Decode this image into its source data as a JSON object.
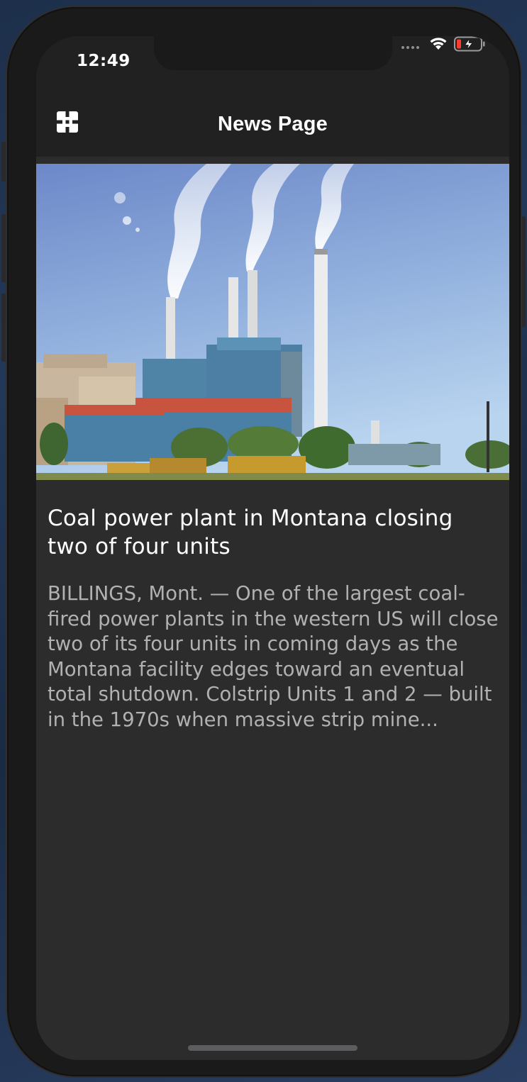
{
  "status_bar": {
    "time": "12:49",
    "signal_icon": "cellular-dots-icon",
    "wifi_icon": "wifi-icon",
    "battery_icon": "battery-low-charging-icon",
    "battery_color": "#ff3b30"
  },
  "app_bar": {
    "title": "News Page",
    "menu_icon": "grid-menu-icon"
  },
  "article": {
    "image_description_icon": "power-plant-photo",
    "headline": "Coal power plant in Montana closing two of four units",
    "summary": "BILLINGS, Mont. — One of the largest coal-fired power plants in the western US will close two of its four units in coming days as the Montana facility edges toward an eventual total shutdown. Colstrip Units 1 and 2 — built in the 1970s when massive strip mine..."
  },
  "colors": {
    "background": "#2c2c2d",
    "app_bar": "#212122",
    "headline": "#ffffff",
    "summary": "#b1b1b2"
  }
}
